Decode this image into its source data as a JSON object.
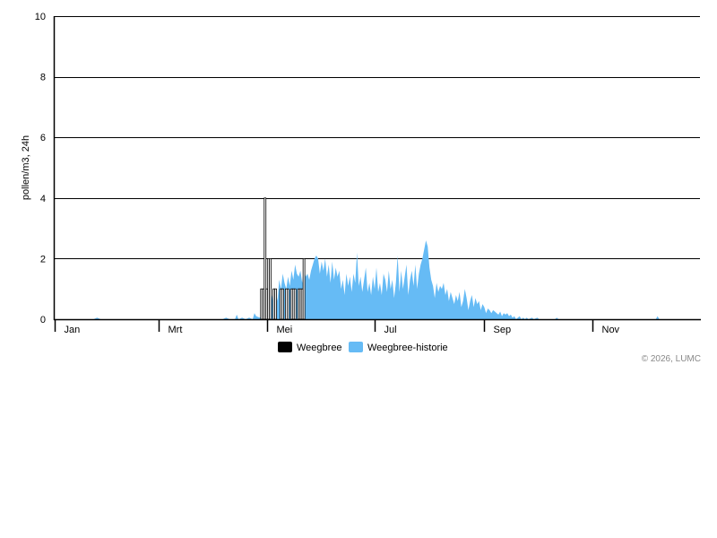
{
  "chart_data": {
    "type": "area",
    "ylabel": "pollen/m3, 24h",
    "ylim": [
      0,
      10
    ],
    "yticks": [
      0,
      2,
      4,
      6,
      8,
      10
    ],
    "x_domain_days": [
      0,
      365
    ],
    "month_labels": [
      "Jan",
      "Mrt",
      "Mei",
      "Jul",
      "Sep",
      "Nov"
    ],
    "month_ticks_day": [
      0,
      59,
      120,
      181,
      243,
      304
    ],
    "grid": "horizontal",
    "legend_position": "bottom-center",
    "credit": "© 2026, LUMC",
    "colors": {
      "history": "#66bbf5",
      "current": "#000000",
      "grid": "#000000"
    },
    "series": [
      {
        "name": "Weegbree",
        "kind": "bars",
        "points": [
          [
            117,
            1.0
          ],
          [
            118,
            1.0
          ],
          [
            119,
            4.0
          ],
          [
            120,
            1.0
          ],
          [
            121,
            2.0
          ],
          [
            122,
            2.0
          ],
          [
            124,
            1.0
          ],
          [
            125,
            1.0
          ],
          [
            128,
            1.0
          ],
          [
            129,
            1.0
          ],
          [
            131,
            1.0
          ],
          [
            132,
            1.0
          ],
          [
            134,
            1.0
          ],
          [
            135,
            1.0
          ],
          [
            136,
            1.0
          ],
          [
            138,
            1.0
          ],
          [
            139,
            1.0
          ],
          [
            140,
            1.0
          ],
          [
            141,
            2.0
          ]
        ]
      },
      {
        "name": "Weegbree-historie",
        "kind": "area",
        "points": [
          [
            0,
            0
          ],
          [
            22,
            0
          ],
          [
            24,
            0.05
          ],
          [
            26,
            0
          ],
          [
            95,
            0
          ],
          [
            97,
            0.05
          ],
          [
            99,
            0
          ],
          [
            102,
            0
          ],
          [
            103,
            0.15
          ],
          [
            104,
            0
          ],
          [
            106,
            0.05
          ],
          [
            108,
            0
          ],
          [
            110,
            0.05
          ],
          [
            112,
            0
          ],
          [
            113,
            0.2
          ],
          [
            114,
            0.1
          ],
          [
            116,
            0.05
          ],
          [
            117,
            0.1
          ],
          [
            118,
            0.3
          ],
          [
            119,
            0.1
          ],
          [
            120,
            0.15
          ],
          [
            121,
            0.5
          ],
          [
            122,
            0.2
          ],
          [
            123,
            0.8
          ],
          [
            124,
            0.4
          ],
          [
            125,
            1.0
          ],
          [
            126,
            0.6
          ],
          [
            127,
            1.3
          ],
          [
            128,
            1.0
          ],
          [
            129,
            1.5
          ],
          [
            130,
            1.2
          ],
          [
            131,
            1.0
          ],
          [
            132,
            1.4
          ],
          [
            133,
            1.1
          ],
          [
            134,
            1.6
          ],
          [
            135,
            1.3
          ],
          [
            136,
            1.8
          ],
          [
            137,
            1.5
          ],
          [
            138,
            1.4
          ],
          [
            139,
            1.6
          ],
          [
            140,
            1.2
          ],
          [
            141,
            1.7
          ],
          [
            142,
            1.4
          ],
          [
            143,
            1.5
          ],
          [
            144,
            1.3
          ],
          [
            145,
            1.6
          ],
          [
            146,
            1.8
          ],
          [
            147,
            2.0
          ],
          [
            148,
            2.1
          ],
          [
            149,
            2.0
          ],
          [
            150,
            1.5
          ],
          [
            151,
            1.9
          ],
          [
            152,
            1.6
          ],
          [
            153,
            2.0
          ],
          [
            154,
            1.4
          ],
          [
            155,
            1.8
          ],
          [
            156,
            1.2
          ],
          [
            157,
            1.9
          ],
          [
            158,
            1.3
          ],
          [
            159,
            1.7
          ],
          [
            160,
            1.4
          ],
          [
            161,
            1.6
          ],
          [
            162,
            1.0
          ],
          [
            163,
            1.3
          ],
          [
            164,
            0.8
          ],
          [
            165,
            1.5
          ],
          [
            166,
            1.1
          ],
          [
            167,
            1.4
          ],
          [
            168,
            0.9
          ],
          [
            169,
            1.5
          ],
          [
            170,
            1.2
          ],
          [
            171,
            2.2
          ],
          [
            172,
            1.1
          ],
          [
            173,
            1.4
          ],
          [
            174,
            0.9
          ],
          [
            175,
            1.3
          ],
          [
            176,
            1.7
          ],
          [
            177,
            0.9
          ],
          [
            178,
            1.2
          ],
          [
            179,
            0.8
          ],
          [
            180,
            1.4
          ],
          [
            181,
            1.0
          ],
          [
            182,
            1.7
          ],
          [
            183,
            0.9
          ],
          [
            184,
            1.2
          ],
          [
            185,
            0.8
          ],
          [
            186,
            1.5
          ],
          [
            187,
            1.3
          ],
          [
            188,
            0.9
          ],
          [
            189,
            1.6
          ],
          [
            190,
            1.0
          ],
          [
            191,
            1.3
          ],
          [
            192,
            0.7
          ],
          [
            193,
            1.2
          ],
          [
            194,
            2.1
          ],
          [
            195,
            0.9
          ],
          [
            196,
            1.6
          ],
          [
            197,
            1.0
          ],
          [
            198,
            1.4
          ],
          [
            199,
            1.8
          ],
          [
            200,
            0.8
          ],
          [
            201,
            1.3
          ],
          [
            202,
            1.6
          ],
          [
            203,
            1.1
          ],
          [
            204,
            1.8
          ],
          [
            205,
            1.0
          ],
          [
            206,
            1.5
          ],
          [
            207,
            1.8
          ],
          [
            208,
            2.0
          ],
          [
            209,
            2.3
          ],
          [
            210,
            2.6
          ],
          [
            211,
            2.4
          ],
          [
            212,
            1.7
          ],
          [
            213,
            1.3
          ],
          [
            214,
            1.1
          ],
          [
            215,
            0.7
          ],
          [
            216,
            1.2
          ],
          [
            217,
            0.9
          ],
          [
            218,
            1.1
          ],
          [
            219,
            1.0
          ],
          [
            220,
            1.2
          ],
          [
            221,
            0.8
          ],
          [
            222,
            1.0
          ],
          [
            223,
            0.6
          ],
          [
            224,
            0.9
          ],
          [
            225,
            0.7
          ],
          [
            226,
            0.5
          ],
          [
            227,
            0.8
          ],
          [
            228,
            0.6
          ],
          [
            229,
            0.9
          ],
          [
            230,
            0.4
          ],
          [
            231,
            0.6
          ],
          [
            232,
            1.0
          ],
          [
            233,
            0.7
          ],
          [
            234,
            0.3
          ],
          [
            235,
            0.6
          ],
          [
            236,
            0.8
          ],
          [
            237,
            0.4
          ],
          [
            238,
            0.7
          ],
          [
            239,
            0.5
          ],
          [
            240,
            0.6
          ],
          [
            241,
            0.3
          ],
          [
            242,
            0.5
          ],
          [
            243,
            0.4
          ],
          [
            244,
            0.2
          ],
          [
            245,
            0.35
          ],
          [
            246,
            0.3
          ],
          [
            247,
            0.2
          ],
          [
            248,
            0.3
          ],
          [
            249,
            0.25
          ],
          [
            250,
            0.2
          ],
          [
            251,
            0.15
          ],
          [
            252,
            0.25
          ],
          [
            253,
            0.1
          ],
          [
            254,
            0.2
          ],
          [
            255,
            0.15
          ],
          [
            256,
            0.2
          ],
          [
            257,
            0.1
          ],
          [
            258,
            0.15
          ],
          [
            259,
            0.05
          ],
          [
            260,
            0.1
          ],
          [
            261,
            0
          ],
          [
            262,
            0.05
          ],
          [
            263,
            0.1
          ],
          [
            264,
            0
          ],
          [
            265,
            0.05
          ],
          [
            266,
            0
          ],
          [
            267,
            0.05
          ],
          [
            268,
            0
          ],
          [
            270,
            0.05
          ],
          [
            271,
            0
          ],
          [
            273,
            0.05
          ],
          [
            274,
            0
          ],
          [
            283,
            0
          ],
          [
            284,
            0.05
          ],
          [
            285,
            0
          ],
          [
            340,
            0
          ],
          [
            341,
            0.1
          ],
          [
            342,
            0
          ],
          [
            365,
            0
          ]
        ]
      }
    ]
  }
}
